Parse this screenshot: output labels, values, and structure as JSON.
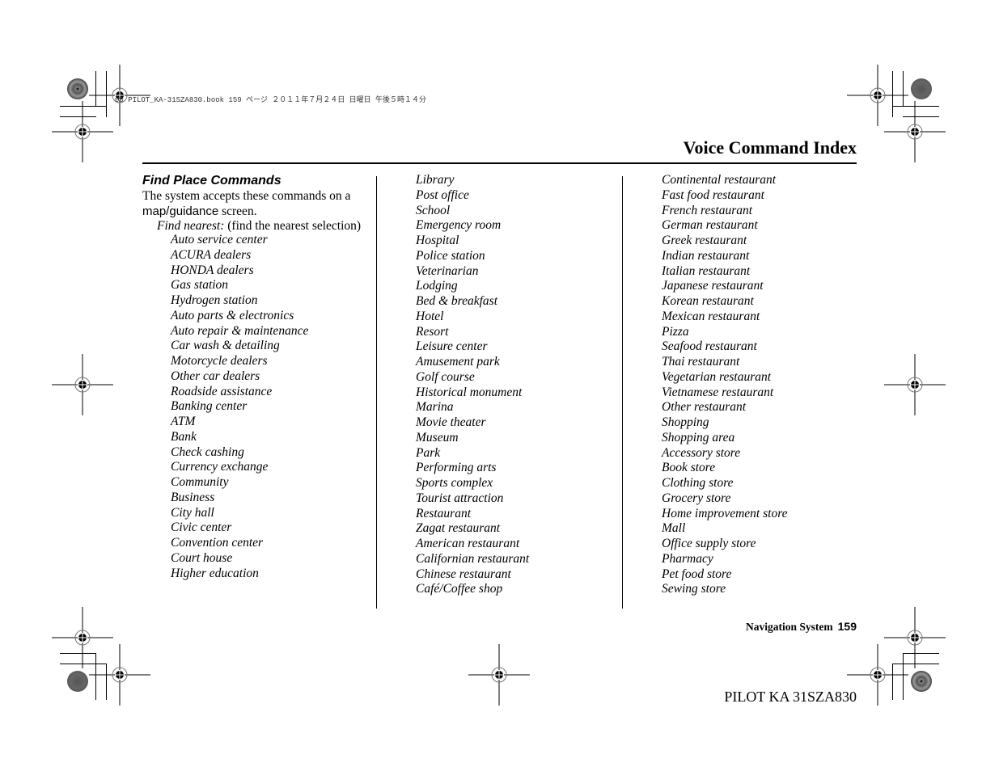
{
  "slug_line": "00 PILOT_KA-31SZA830.book  159 ページ  ２０１１年７月２４日  日曜日  午後５時１４分",
  "header": {
    "title": "Voice Command Index"
  },
  "section": {
    "heading": "Find Place Commands",
    "intro_part1": "The system accepts these commands on a ",
    "intro_highlight": "map/guidance",
    "intro_part2": " screen.",
    "find_nearest_label": "Find nearest:",
    "find_nearest_desc": " (find the nearest selection)"
  },
  "columns": [
    {
      "items": [
        "Auto service center",
        "ACURA dealers",
        "HONDA dealers",
        "Gas station",
        "Hydrogen station",
        "Auto parts & electronics",
        "Auto repair & maintenance",
        "Car wash & detailing",
        "Motorcycle dealers",
        "Other car dealers",
        "Roadside assistance",
        "Banking center",
        "ATM",
        "Bank",
        "Check cashing",
        "Currency exchange",
        "Community",
        "Business",
        "City hall",
        "Civic center",
        "Convention center",
        "Court house",
        "Higher education"
      ]
    },
    {
      "items": [
        "Library",
        "Post office",
        "School",
        "Emergency room",
        "Hospital",
        "Police station",
        "Veterinarian",
        "Lodging",
        "Bed & breakfast",
        "Hotel",
        "Resort",
        "Leisure center",
        "Amusement park",
        "Golf course",
        "Historical monument",
        "Marina",
        "Movie theater",
        "Museum",
        "Park",
        "Performing arts",
        "Sports complex",
        "Tourist attraction",
        "Restaurant",
        "Zagat restaurant",
        "American restaurant",
        "Californian restaurant",
        "Chinese restaurant",
        "Café/Coffee shop"
      ]
    },
    {
      "items": [
        "Continental restaurant",
        "Fast food restaurant",
        "French restaurant",
        "German restaurant",
        "Greek restaurant",
        "Indian restaurant",
        "Italian restaurant",
        "Japanese restaurant",
        "Korean restaurant",
        "Mexican restaurant",
        "Pizza",
        "Seafood restaurant",
        "Thai restaurant",
        "Vegetarian restaurant",
        "Vietnamese restaurant",
        "Other restaurant",
        "Shopping",
        "Shopping area",
        "Accessory store",
        "Book store",
        "Clothing store",
        "Grocery store",
        "Home improvement store",
        "Mall",
        "Office supply store",
        "Pharmacy",
        "Pet food store",
        "Sewing store"
      ]
    }
  ],
  "footer": {
    "section_name": "Navigation System",
    "page_number": "159",
    "book_code": "PILOT KA  31SZA830"
  }
}
